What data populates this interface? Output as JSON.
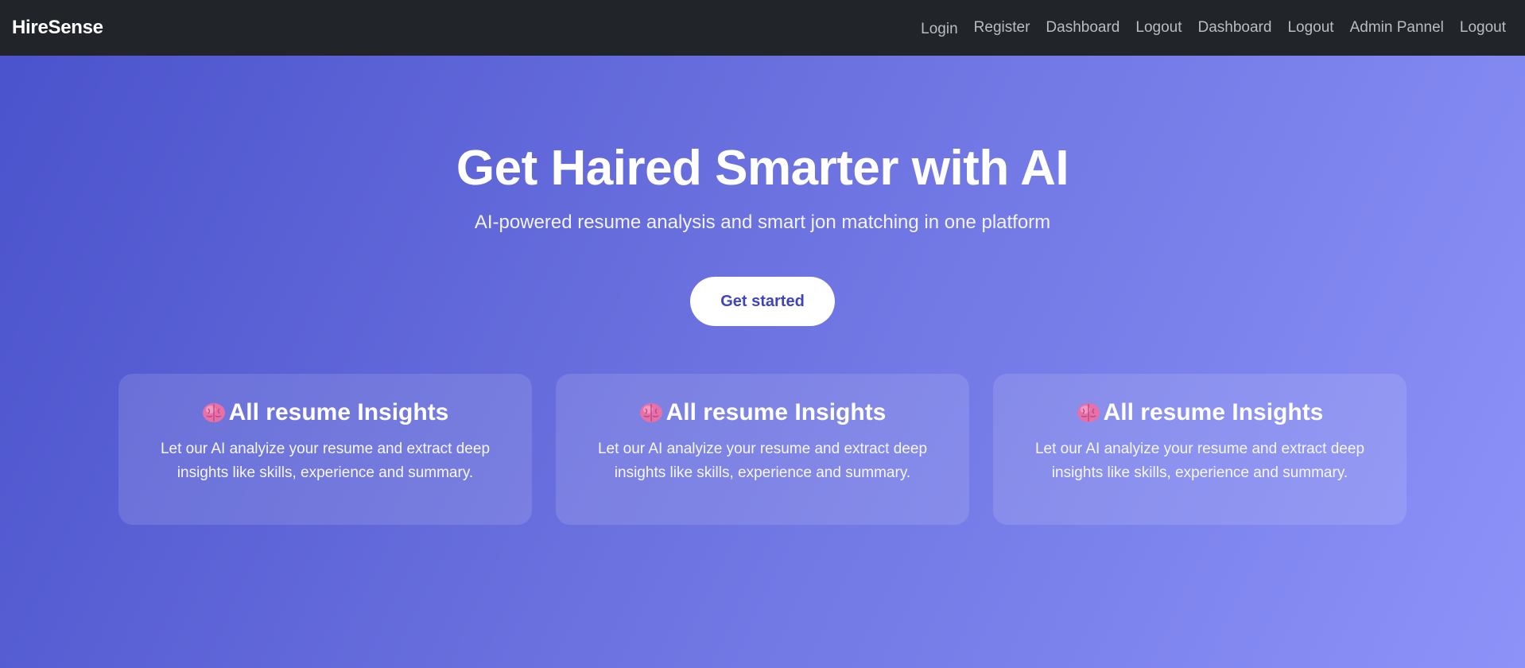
{
  "navbar": {
    "brand": "HireSense",
    "links": [
      "Login",
      "Register",
      "Dashboard",
      "Logout",
      "Dashboard",
      "Logout",
      "Admin Pannel",
      "Logout"
    ]
  },
  "hero": {
    "title": "Get Haired Smarter with AI",
    "subtitle": "AI-powered resume analysis and smart jon matching in one platform",
    "cta_label": "Get started"
  },
  "features": [
    {
      "icon": "brain-icon",
      "title": "All resume Insights",
      "description": "Let our AI analyize your resume and extract deep insights like skills, experience and summary."
    },
    {
      "icon": "brain-icon",
      "title": "All resume Insights",
      "description": "Let our AI analyize your resume and extract deep insights like skills, experience and summary."
    },
    {
      "icon": "brain-icon",
      "title": "All resume Insights",
      "description": "Let our AI analyize your resume and extract deep insights like skills, experience and summary."
    }
  ],
  "colors": {
    "navbar_bg": "#212529",
    "gradient_start": "#4a52cc",
    "gradient_end": "#8c92f8",
    "cta_text": "#3f45b8",
    "icon_pink": "#e86fa8"
  }
}
